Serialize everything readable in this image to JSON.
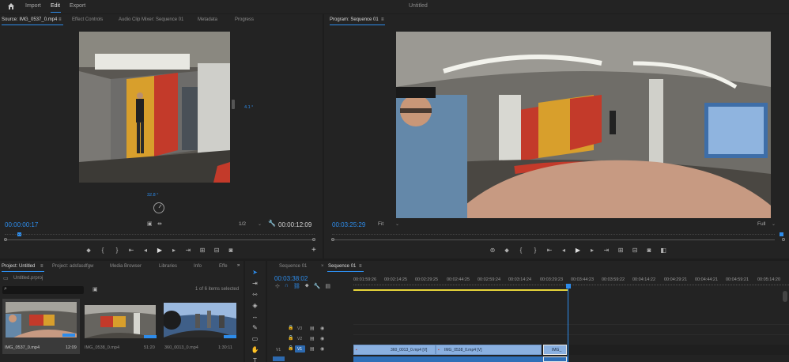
{
  "topbar": {
    "home_icon": "home-icon",
    "nav": [
      "Import",
      "Edit",
      "Export"
    ],
    "title": "Untitled"
  },
  "source_panel": {
    "tabs": [
      "Source: IMG_0537_0.mp4",
      "Effect Controls",
      "Audio Clip Mixer: Sequence 01",
      "Metadata",
      "Progress"
    ],
    "menu_glyph": "≡",
    "angle_right": "4.1 °",
    "angle_bottom": "32.8 °",
    "timecode": "00:00:00:17",
    "resolution": "1/2",
    "duration": "00:00:12:09",
    "add": "+"
  },
  "program_panel": {
    "title": "Program: Sequence 01",
    "menu_glyph": "≡",
    "timecode": "00:03:25:29",
    "fit": "Fit",
    "quality": "Full"
  },
  "project_panel": {
    "tabs": [
      "Project: Untitled",
      "Project: adsfasdfgw",
      "Media Browser",
      "Libraries",
      "Info",
      "Effe"
    ],
    "more": "»",
    "menu_glyph": "≡",
    "project_file": "Untitled.prproj",
    "items_selected": "1 of 6 items selected",
    "clips": [
      {
        "name": "IMG_0537_0.mp4",
        "duration": "12:09"
      },
      {
        "name": "IMG_0538_0.mp4",
        "duration": "51:20"
      },
      {
        "name": "360_0013_0.mp4",
        "duration": "1:30:11"
      }
    ]
  },
  "timeline": {
    "tabs": [
      "Sequence 01",
      "Sequence 01"
    ],
    "menu_glyph": "≡",
    "timecode": "00:03:38:02",
    "ruler": [
      "00:01:59:26",
      "00:02:14:25",
      "00:02:29:25",
      "00:02:44:25",
      "00:02:59:24",
      "00:03:14:24",
      "00:03:29:23",
      "00:03:44:23",
      "00:03:59:22",
      "00:04:14:22",
      "00:04:29:21",
      "00:04:44:21",
      "00:04:59:21",
      "00:05:14:20"
    ],
    "tracks": [
      "V3",
      "V2",
      "V1"
    ],
    "v1_source": "V1",
    "clips": [
      "360_0013_0.mp4 [V]",
      "IMG_0538_0.mp4 [V]",
      "IMG_"
    ]
  }
}
